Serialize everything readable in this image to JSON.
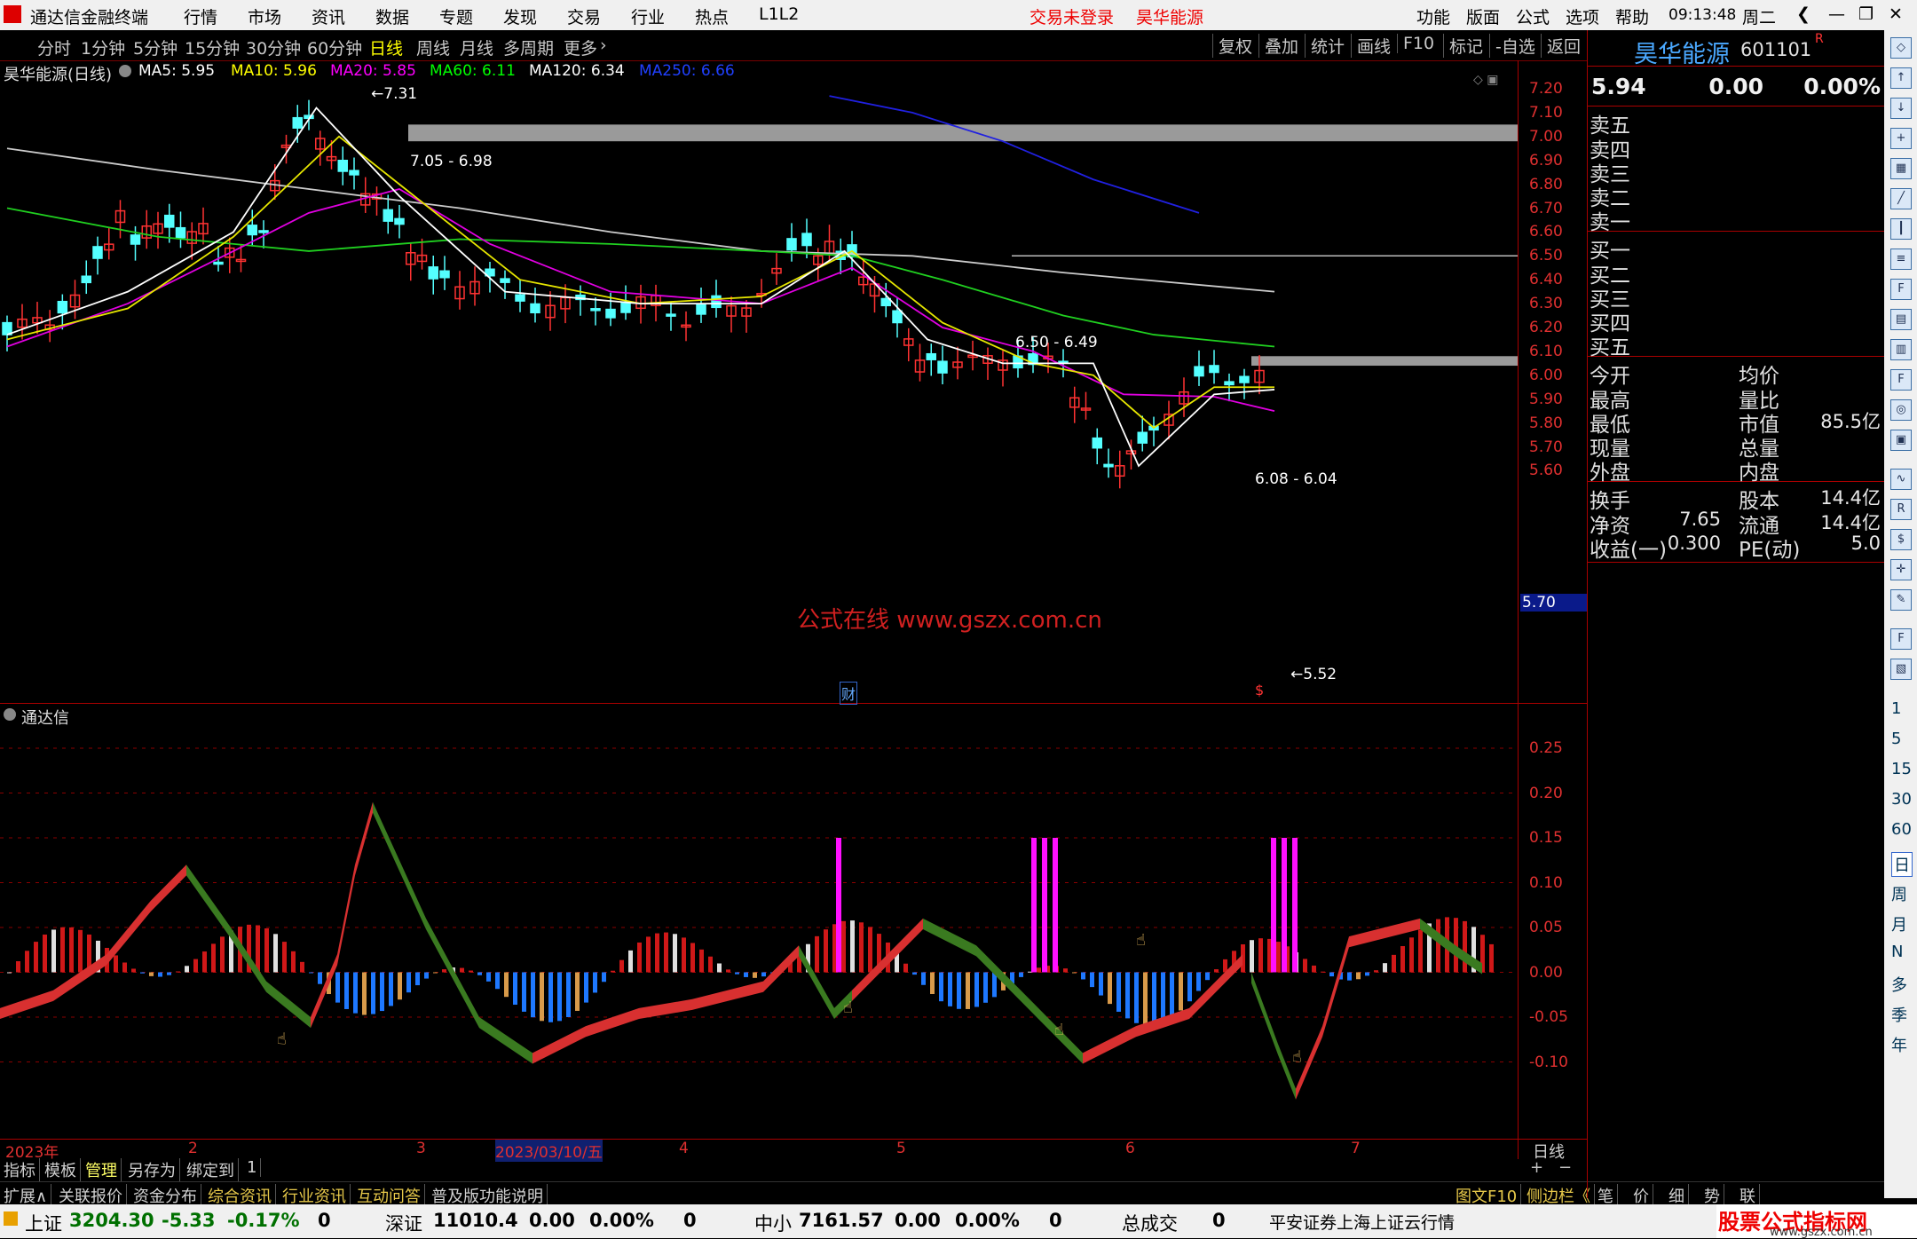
{
  "menubar": {
    "app_title": "通达信金融终端",
    "items": [
      "行情",
      "市场",
      "资讯",
      "数据",
      "专题",
      "发现",
      "交易",
      "行业",
      "热点",
      "L1L2"
    ],
    "trade_status": "交易未登录",
    "stock_name": "昊华能源",
    "right_items": [
      "功能",
      "版面",
      "公式",
      "选项",
      "帮助"
    ],
    "time": "09:13:48",
    "weekday": "周二"
  },
  "toolbar": {
    "periods": [
      "分时",
      "1分钟",
      "5分钟",
      "15分钟",
      "30分钟",
      "60分钟",
      "日线",
      "周线",
      "月线",
      "多周期",
      "更多"
    ],
    "active_period": "日线",
    "right_buttons": [
      "复权",
      "叠加",
      "统计",
      "画线",
      "F10",
      "标记",
      "-自选",
      "返回"
    ]
  },
  "main_chart": {
    "stock_label": "昊华能源(日线)",
    "ma_labels": [
      {
        "text": "MA5: 5.95",
        "color": "#ffffff"
      },
      {
        "text": "MA10: 5.96",
        "color": "#ffff00"
      },
      {
        "text": "MA20: 5.85",
        "color": "#ff00ff"
      },
      {
        "text": "MA60: 6.11",
        "color": "#00ff00"
      },
      {
        "text": "MA120: 6.34",
        "color": "#ffffff"
      },
      {
        "text": "MA250: 6.66",
        "color": "#0000ff"
      }
    ],
    "y_ticks": [
      "7.20",
      "7.10",
      "7.00",
      "6.90",
      "6.80",
      "6.70",
      "6.60",
      "6.50",
      "6.40",
      "6.30",
      "6.20",
      "6.10",
      "6.00",
      "5.90",
      "5.80",
      "5.70",
      "5.60"
    ],
    "current_price_tag": "5.70",
    "annotations": {
      "high": "7.31",
      "low": "5.52",
      "zone1": "7.05 - 6.98",
      "zone2": "6.50 - 6.49",
      "zone3": "6.08 - 6.04"
    },
    "watermark": "公式在线 www.gszx.com.cn",
    "event_markers": [
      "财",
      "$"
    ]
  },
  "sub_chart": {
    "label": "通达信",
    "y_ticks": [
      "0.25",
      "0.20",
      "0.15",
      "0.10",
      "0.05",
      "0.00",
      "-0.05",
      "-0.10"
    ]
  },
  "date_axis": {
    "labels": [
      "2023年",
      "2",
      "3",
      "2023/03/10/五",
      "4",
      "5",
      "6",
      "7"
    ],
    "period_label": "日线"
  },
  "bottom_tabs_row1": [
    "指标",
    "模板",
    "管理",
    "另存为",
    "绑定到",
    "1"
  ],
  "bottom_tabs_row2": [
    "扩展∧",
    "关联报价",
    "资金分布",
    "综合资讯",
    "行业资讯",
    "互动问答",
    "普及版功能说明"
  ],
  "bottom_right_row2": [
    "图文F10",
    "侧边栏《",
    "笔",
    "价",
    "细",
    "势",
    "联"
  ],
  "right_panel": {
    "stock_name": "昊华能源",
    "stock_code": "601101",
    "badge": "R",
    "price": "5.94",
    "change": "0.00",
    "change_pct": "0.00%",
    "sell_levels": [
      "卖五",
      "卖四",
      "卖三",
      "卖二",
      "卖一"
    ],
    "buy_levels": [
      "买一",
      "买二",
      "买三",
      "买四",
      "买五"
    ],
    "stats_left": [
      {
        "label": "今开",
        "value": ""
      },
      {
        "label": "最高",
        "value": ""
      },
      {
        "label": "最低",
        "value": ""
      },
      {
        "label": "现量",
        "value": ""
      },
      {
        "label": "外盘",
        "value": ""
      }
    ],
    "stats_right": [
      {
        "label": "均价",
        "value": ""
      },
      {
        "label": "量比",
        "value": ""
      },
      {
        "label": "市值",
        "value": "85.5亿"
      },
      {
        "label": "总量",
        "value": ""
      },
      {
        "label": "内盘",
        "value": ""
      }
    ],
    "fin_left": [
      {
        "label": "换手",
        "value": ""
      },
      {
        "label": "净资",
        "value": "7.65"
      },
      {
        "label": "收益(一)",
        "value": "0.300"
      }
    ],
    "fin_right": [
      {
        "label": "股本",
        "value": "14.4亿"
      },
      {
        "label": "流通",
        "value": "14.4亿"
      },
      {
        "label": "PE(动)",
        "value": "5.0"
      }
    ]
  },
  "side_icons": [
    "1",
    "5",
    "15",
    "30",
    "60",
    "日",
    "周",
    "月",
    "N",
    "多",
    "季",
    "年"
  ],
  "statusbar": {
    "items": [
      {
        "name": "上证",
        "value": "3204.30",
        "change": "-5.33",
        "pct": "-0.17%",
        "vol": "0"
      },
      {
        "name": "深证",
        "value": "11010.4",
        "change": "0.00",
        "pct": "0.00%",
        "vol": "0"
      },
      {
        "name": "中小",
        "value": "7161.57",
        "change": "0.00",
        "pct": "0.00%",
        "vol": "0"
      }
    ],
    "total_label": "总成交",
    "total_value": "0",
    "broker": "平安证券上海上证云行情",
    "site_brand": "股票公式指标网",
    "site_url": "www.gszx.com.cn"
  }
}
